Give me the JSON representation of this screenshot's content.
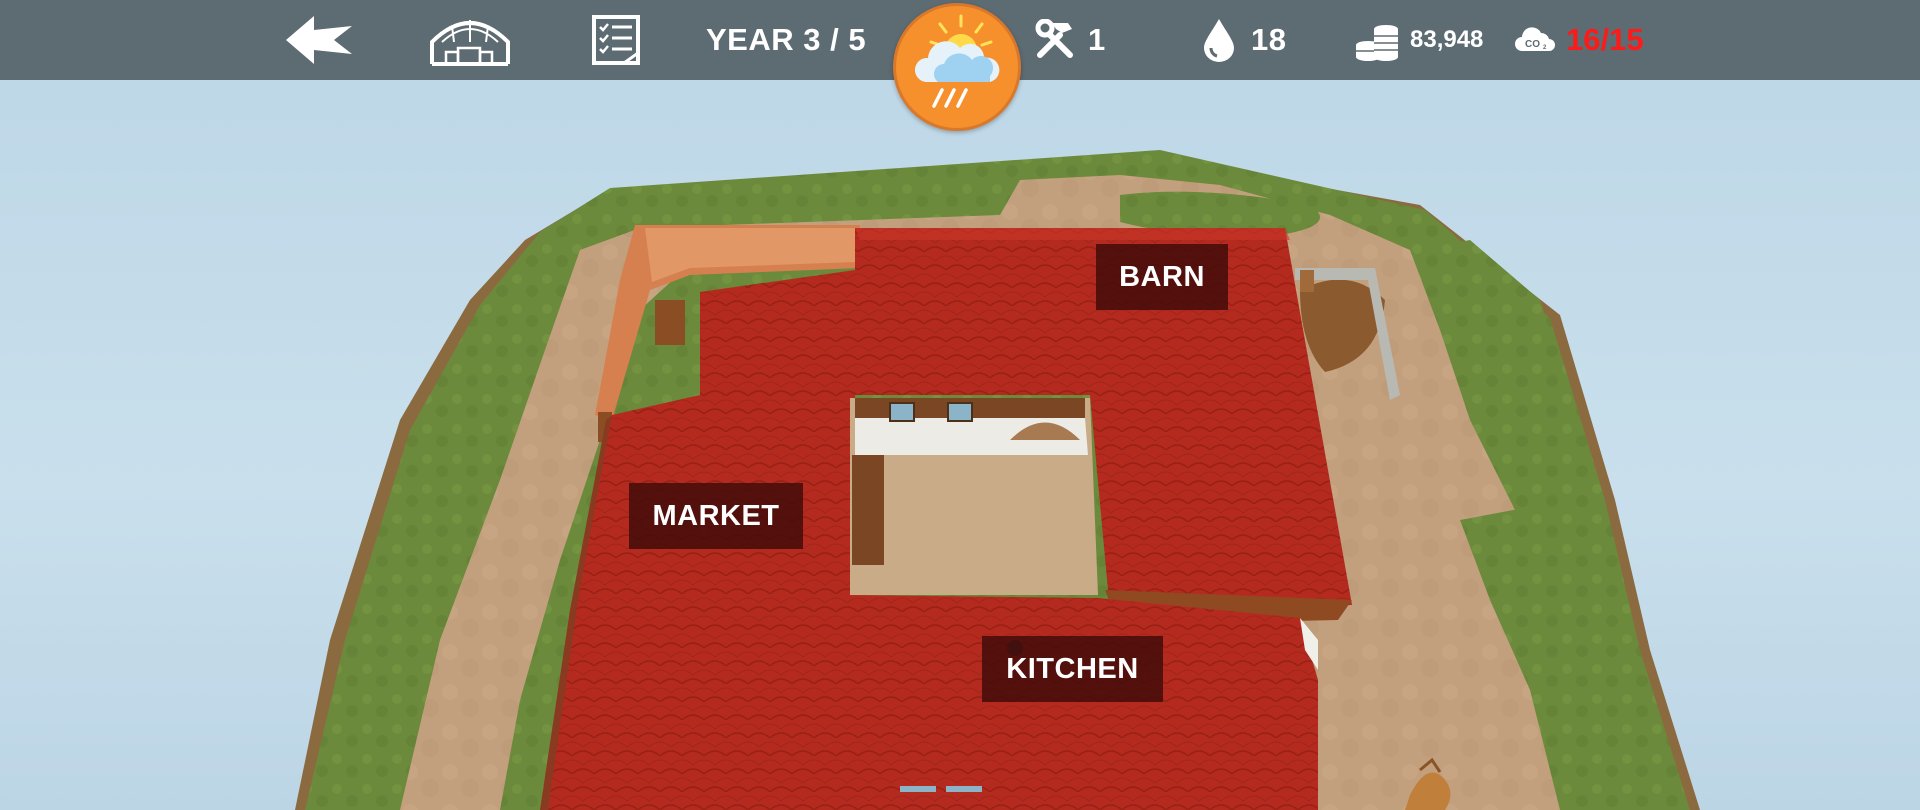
{
  "hud": {
    "back_icon": "back-arrow-icon",
    "farm_icon": "farm-shed-icon",
    "tasks_icon": "checklist-icon",
    "year_label": "YEAR 3 / 5",
    "weather_icon": "sun-cloud-rain-icon",
    "tools_icon": "hammer-wrench-icon",
    "tools_count": "1",
    "water_icon": "water-drop-icon",
    "water_count": "18",
    "coins_icon": "coin-stack-icon",
    "coins_count": "83,948",
    "co2_icon": "co2-cloud-icon",
    "co2_value": "16/15"
  },
  "buildings": {
    "barn": "BARN",
    "market": "MARKET",
    "kitchen": "KITCHEN"
  },
  "colors": {
    "hud_bar": "#5d6b72",
    "weather_button": "#f6902d",
    "co2_over_limit": "#ff1a1a",
    "roof_red": "#b82a1e",
    "grass_green": "#6a8a3a",
    "dirt_path": "#c4a07c",
    "label_bg": "#460c0a"
  }
}
